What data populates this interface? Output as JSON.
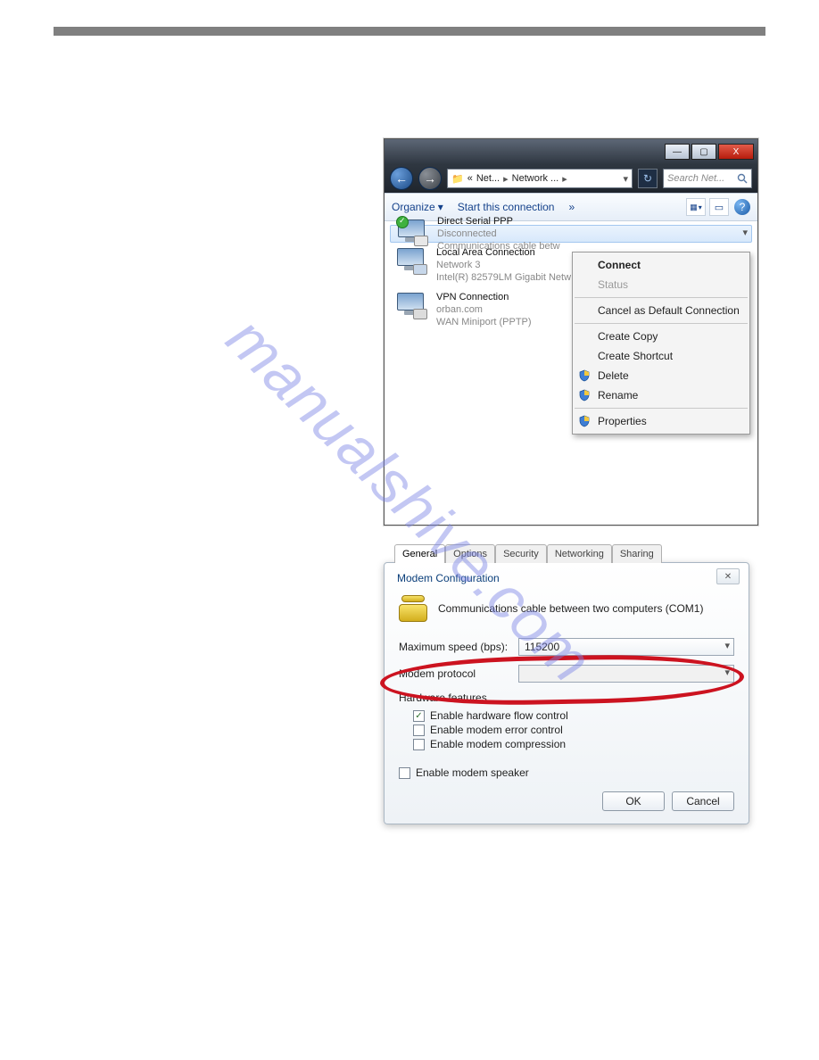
{
  "watermark": "manualshive.com",
  "window1": {
    "titlebar": {
      "min": "—",
      "max": "▢",
      "close": "X"
    },
    "nav": {
      "back": "←",
      "fwd": "→",
      "path_prefix": "«",
      "path_seg1": "Net...",
      "path_seg2": "Network ...",
      "sep": "▸",
      "refresh": "↻",
      "search_placeholder": "Search Net..."
    },
    "toolbar": {
      "organize": "Organize",
      "organize_caret": "▾",
      "start": "Start this connection",
      "more": "»",
      "view_caret": "▾",
      "help": "?"
    },
    "connections": [
      {
        "name": "Direct Serial PPP",
        "line2": "Disconnected",
        "line3": "Communications cable betw"
      },
      {
        "name": "Local Area Connection",
        "line2": "Network 3",
        "line3": "Intel(R) 82579LM Gigabit Netw"
      },
      {
        "name": "VPN Connection",
        "line2": "orban.com",
        "line3": "WAN Miniport (PPTP)"
      }
    ],
    "context_menu": {
      "connect": "Connect",
      "status": "Status",
      "cancel_default": "Cancel as Default Connection",
      "create_copy": "Create Copy",
      "create_shortcut": "Create Shortcut",
      "delete": "Delete",
      "rename": "Rename",
      "properties": "Properties"
    }
  },
  "window2": {
    "tabs": [
      "General",
      "Options",
      "Security",
      "Networking",
      "Sharing"
    ],
    "dialog_title": "Modem Configuration",
    "close": "✕",
    "device": "Communications cable between two computers (COM1)",
    "max_speed_label": "Maximum speed (bps):",
    "max_speed_value": "115200",
    "modem_protocol_label": "Modem protocol",
    "modem_protocol_value": "",
    "hw_title": "Hardware features",
    "hw_flow": "Enable hardware flow control",
    "hw_err": "Enable modem error control",
    "hw_comp": "Enable modem compression",
    "speaker": "Enable modem speaker",
    "ok": "OK",
    "cancel": "Cancel",
    "checkmark": "✓"
  }
}
